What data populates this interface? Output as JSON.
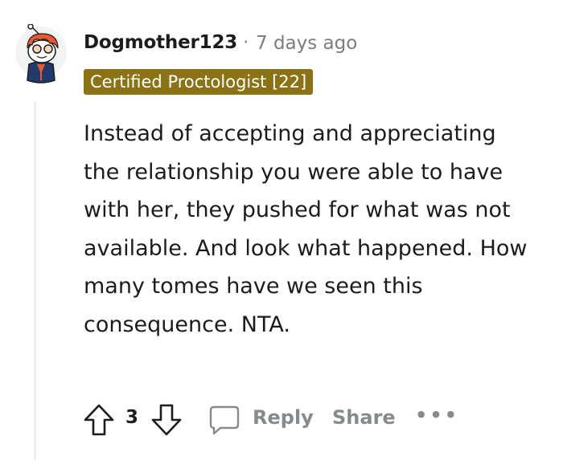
{
  "comment": {
    "author": "Dogmother123",
    "separator": "·",
    "time_ago": "7 days ago",
    "flair": "Certified Proctologist [22]",
    "body": "Instead of accepting and appreciating the relationship you were able to have with her, they pushed for what was not available. And look what happened. How many tomes have we seen this consequence. NTA."
  },
  "actions": {
    "score": "3",
    "reply_label": "Reply",
    "share_label": "Share",
    "more_label": "•••"
  },
  "colors": {
    "flair_bg": "#8b7214",
    "meta_gray": "#878a8c",
    "avatar_orange": "#e9592d",
    "avatar_navy": "#1f3a6b"
  },
  "icons": [
    "snoo-avatar",
    "upvote-icon",
    "downvote-icon",
    "comment-icon",
    "more-icon"
  ]
}
